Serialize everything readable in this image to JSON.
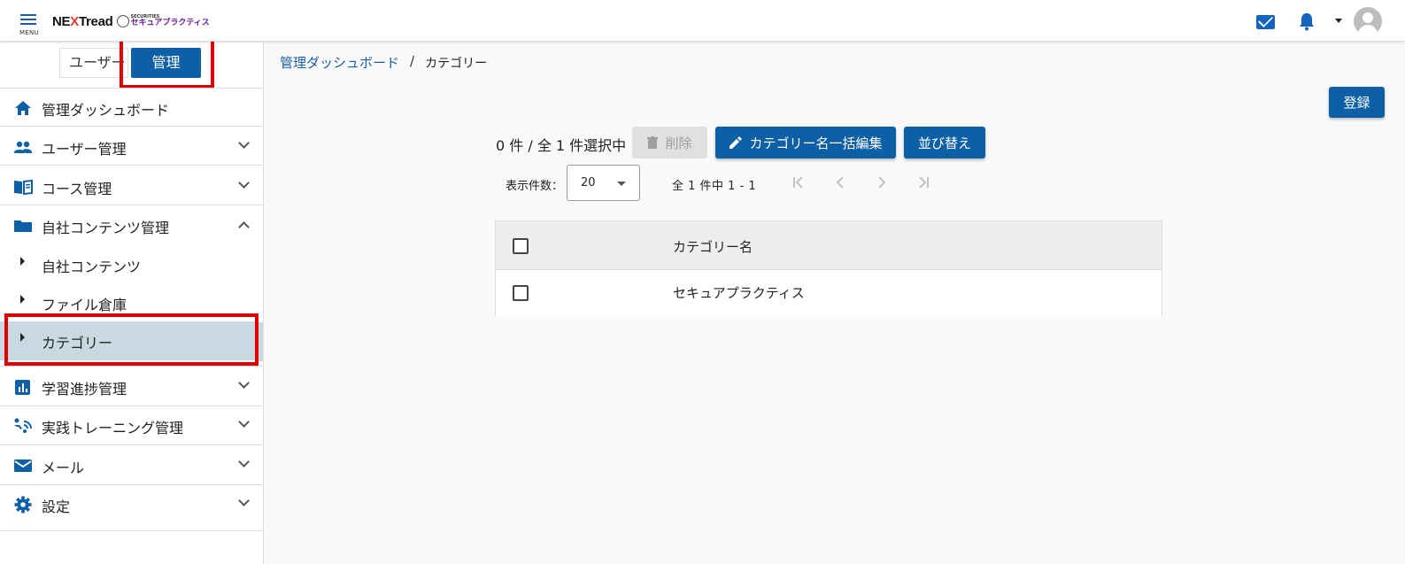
{
  "header": {
    "menu_label": "MENU",
    "logo_main_pre": "NE",
    "logo_main_x": "X",
    "logo_main_post": "Tread",
    "logo_sub_top": "SECURITIES",
    "logo_sub": "セキュアプラクティス"
  },
  "role_switch": {
    "user": "ユーザー",
    "admin": "管理"
  },
  "sidebar": {
    "items": [
      {
        "label": "管理ダッシュボード",
        "icon": "home-icon"
      },
      {
        "label": "ユーザー管理",
        "icon": "users-icon"
      },
      {
        "label": "コース管理",
        "icon": "book-icon"
      },
      {
        "label": "自社コンテンツ管理",
        "icon": "folder-icon"
      },
      {
        "label": "学習進捗管理",
        "icon": "chart-icon"
      },
      {
        "label": "実践トレーニング管理",
        "icon": "training-icon"
      },
      {
        "label": "メール",
        "icon": "mail-icon"
      },
      {
        "label": "設定",
        "icon": "gear-icon"
      }
    ],
    "sub_items": [
      {
        "label": "自社コンテンツ"
      },
      {
        "label": "ファイル倉庫"
      },
      {
        "label": "カテゴリー"
      }
    ]
  },
  "breadcrumb": {
    "parent": "管理ダッシュボード",
    "separator": "/",
    "current": "カテゴリー"
  },
  "toolbar": {
    "register": "登録",
    "selection": "0 件 / 全 1 件選択中",
    "delete": "削除",
    "bulk_edit": "カテゴリー名一括編集",
    "sort": "並び替え"
  },
  "pagination": {
    "per_page_label": "表示件数：",
    "per_page_value": "20",
    "range": "全 1 件中 1 - 1"
  },
  "table": {
    "header": "カテゴリー名",
    "rows": [
      {
        "name": "セキュアプラクティス"
      }
    ]
  },
  "colors": {
    "primary": "#0d5fa6",
    "active_bg": "#c8d9e1",
    "highlight_red": "#e00000"
  }
}
